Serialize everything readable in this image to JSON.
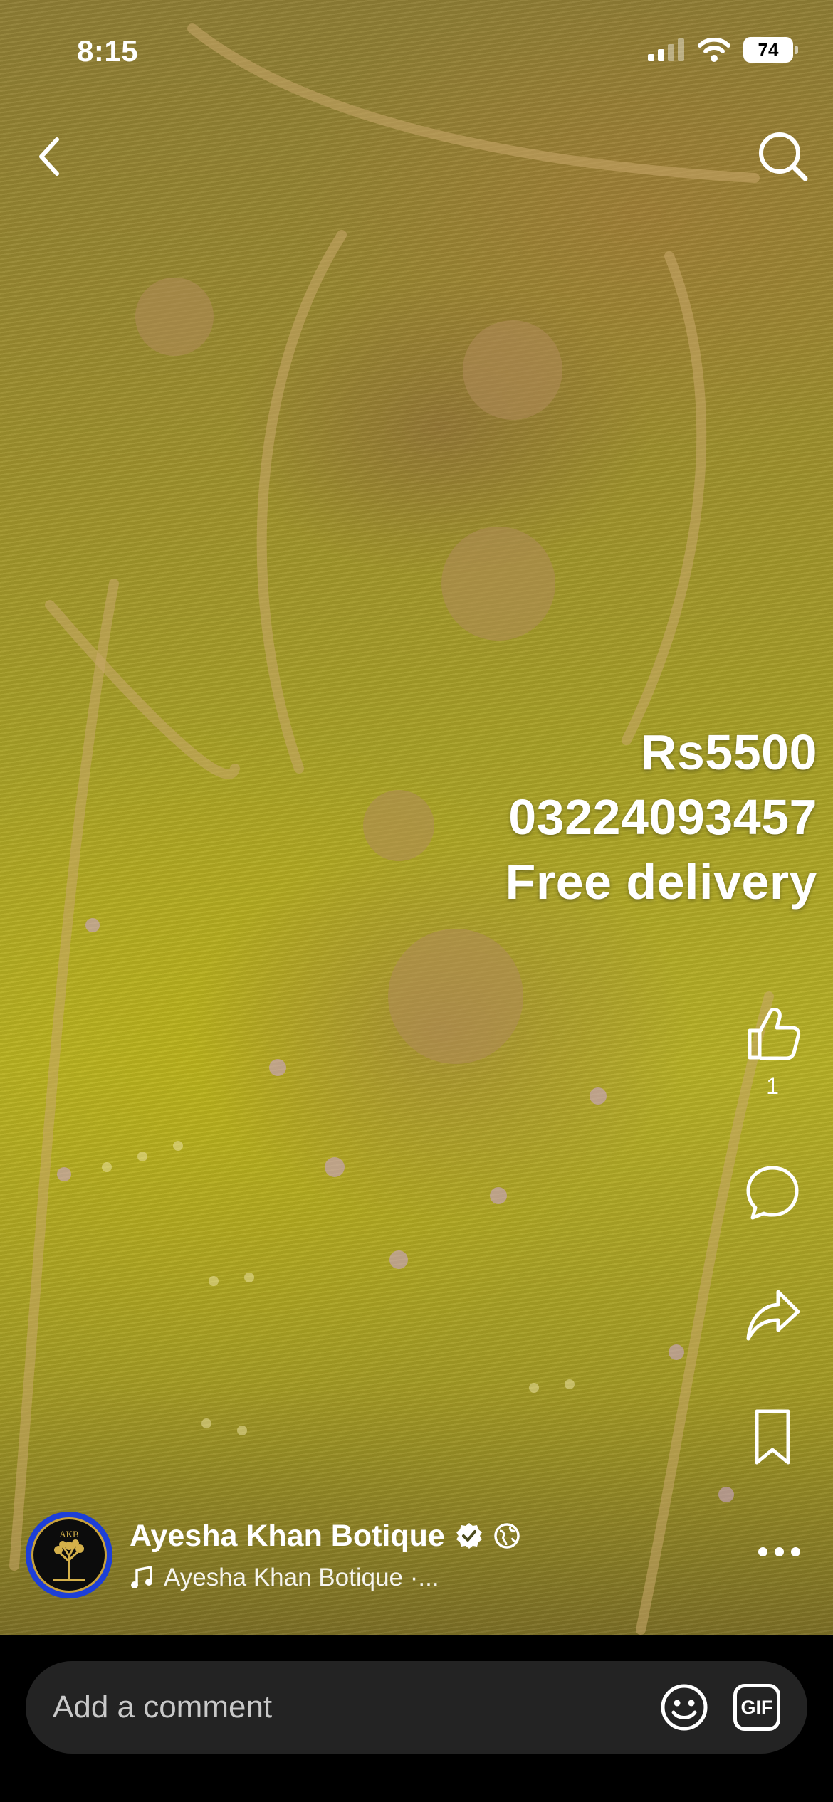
{
  "status_bar": {
    "time": "8:15",
    "battery": "74"
  },
  "overlay": {
    "price": "Rs5500",
    "phone": "03224093457",
    "delivery": "Free delivery"
  },
  "actions": {
    "like_count": "1"
  },
  "author": {
    "name": "Ayesha Khan Botique",
    "avatar_text": "AKB",
    "audio": "Ayesha Khan Botique ·..."
  },
  "comment": {
    "placeholder": "Add a comment",
    "gif_label": "GIF"
  },
  "icons": {
    "back": "chevron-left-icon",
    "search": "search-icon",
    "like": "thumbs-up-icon",
    "comment": "comment-icon",
    "share": "share-icon",
    "save": "bookmark-icon",
    "more": "more-icon",
    "emoji": "emoji-icon",
    "music": "music-note-icon",
    "verified": "verified-badge-icon",
    "globe": "public-audience-icon"
  },
  "colors": {
    "avatar_ring": "#1d3fd8",
    "comment_bar_bg": "#232323"
  }
}
